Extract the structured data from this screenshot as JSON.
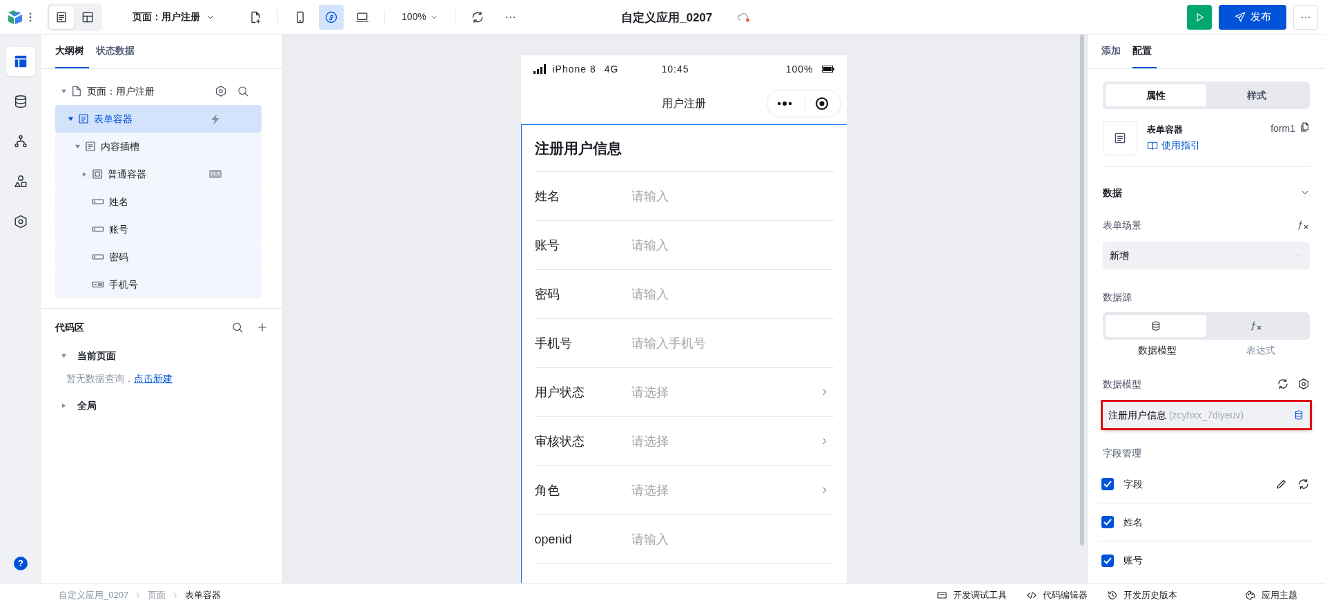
{
  "toolbar": {
    "view_tabs": [
      {
        "kind": "outline",
        "selected": true
      },
      {
        "kind": "layout",
        "selected": false
      }
    ],
    "page_selector": "页面：用户注册",
    "devices": [
      {
        "kind": "phone",
        "selected": false
      },
      {
        "kind": "miniprogram",
        "selected": true
      },
      {
        "kind": "desktop",
        "selected": false
      }
    ],
    "zoom": "100%",
    "more": "···",
    "app_title": "自定义应用_0207",
    "unsaved": true,
    "publish_button": "发布",
    "more_button": "···"
  },
  "rail": {
    "items": [
      {
        "kind": "outline",
        "selected": true
      },
      {
        "kind": "data",
        "selected": false
      },
      {
        "kind": "flow",
        "selected": false
      },
      {
        "kind": "components",
        "selected": false
      },
      {
        "kind": "settings",
        "selected": false
      }
    ],
    "help": "?"
  },
  "outline": {
    "tabs": [
      {
        "label": "大纲树",
        "selected": true
      },
      {
        "label": "状态数据",
        "selected": false
      }
    ],
    "tree": [
      {
        "label": "页面：用户注册",
        "kind": "page",
        "expanded": true,
        "children": [
          {
            "label": "表单容器",
            "kind": "form",
            "selected": true,
            "expanded": true,
            "children": [
              {
                "label": "内容插槽",
                "kind": "form",
                "selected": false,
                "expanded": true,
                "children": [
                  {
                    "label": "普通容器",
                    "kind": "container",
                    "selected": false,
                    "expanded": false,
                    "tag": "CLS"
                  },
                  {
                    "label": "姓名",
                    "kind": "input",
                    "selected": false
                  },
                  {
                    "label": "账号",
                    "kind": "input",
                    "selected": false
                  },
                  {
                    "label": "密码",
                    "kind": "input",
                    "selected": false
                  },
                  {
                    "label": "手机号",
                    "kind": "phone",
                    "selected": false
                  }
                ]
              }
            ]
          }
        ]
      }
    ]
  },
  "code_area": {
    "title": "代码区",
    "groups": [
      {
        "label": "当前页面",
        "expanded": true,
        "empty_text": "暂无数据查询，",
        "link": "点击新建"
      },
      {
        "label": "全局",
        "expanded": false
      }
    ]
  },
  "phone": {
    "device": "iPhone 8",
    "network": "4G",
    "time": "10:45",
    "battery": "100%",
    "nav_title": "用户注册",
    "form": {
      "title": "注册用户信息",
      "fields": [
        {
          "label": "姓名",
          "placeholder": "请输入",
          "kind": "input"
        },
        {
          "label": "账号",
          "placeholder": "请输入",
          "kind": "input"
        },
        {
          "label": "密码",
          "placeholder": "请输入",
          "kind": "input"
        },
        {
          "label": "手机号",
          "placeholder": "请输入手机号",
          "kind": "input"
        },
        {
          "label": "用户状态",
          "placeholder": "请选择",
          "kind": "select"
        },
        {
          "label": "审核状态",
          "placeholder": "请选择",
          "kind": "select"
        },
        {
          "label": "角色",
          "placeholder": "请选择",
          "kind": "select"
        },
        {
          "label": "openid",
          "placeholder": "请输入",
          "kind": "input"
        }
      ]
    }
  },
  "config": {
    "tabs": [
      {
        "label": "添加",
        "selected": false
      },
      {
        "label": "配置",
        "selected": true
      }
    ],
    "segments": [
      {
        "label": "属性",
        "selected": true
      },
      {
        "label": "样式",
        "selected": false
      }
    ],
    "component": {
      "name": "表单容器",
      "guide_link": "使用指引",
      "id": "form1"
    },
    "section": {
      "title": "数据",
      "expanded": true
    },
    "scene": {
      "label": "表单场景",
      "value": "新增"
    },
    "data_source": {
      "label": "数据源",
      "options": [
        {
          "label": "数据模型",
          "kind": "model",
          "selected": true
        },
        {
          "label": "表达式",
          "kind": "expression",
          "selected": false
        }
      ]
    },
    "data_model": {
      "label": "数据模型",
      "value": "注册用户信息",
      "id": "(zcyhxx_7diyeuv)",
      "highlighted": true
    },
    "field_management": {
      "label": "字段管理",
      "fields": [
        {
          "label": "字段",
          "kind": "header",
          "checked": true
        },
        {
          "label": "姓名",
          "kind": "field",
          "checked": true
        },
        {
          "label": "账号",
          "kind": "field",
          "checked": true
        }
      ]
    }
  },
  "status_bar": {
    "breadcrumb": [
      "自定义应用_0207",
      "页面",
      "表单容器"
    ],
    "tools": [
      {
        "label": "开发调试工具",
        "kind": "debug"
      },
      {
        "label": "代码编辑器",
        "kind": "code"
      },
      {
        "label": "开发历史版本",
        "kind": "history"
      },
      {
        "label": "应用主题",
        "kind": "theme"
      }
    ]
  }
}
